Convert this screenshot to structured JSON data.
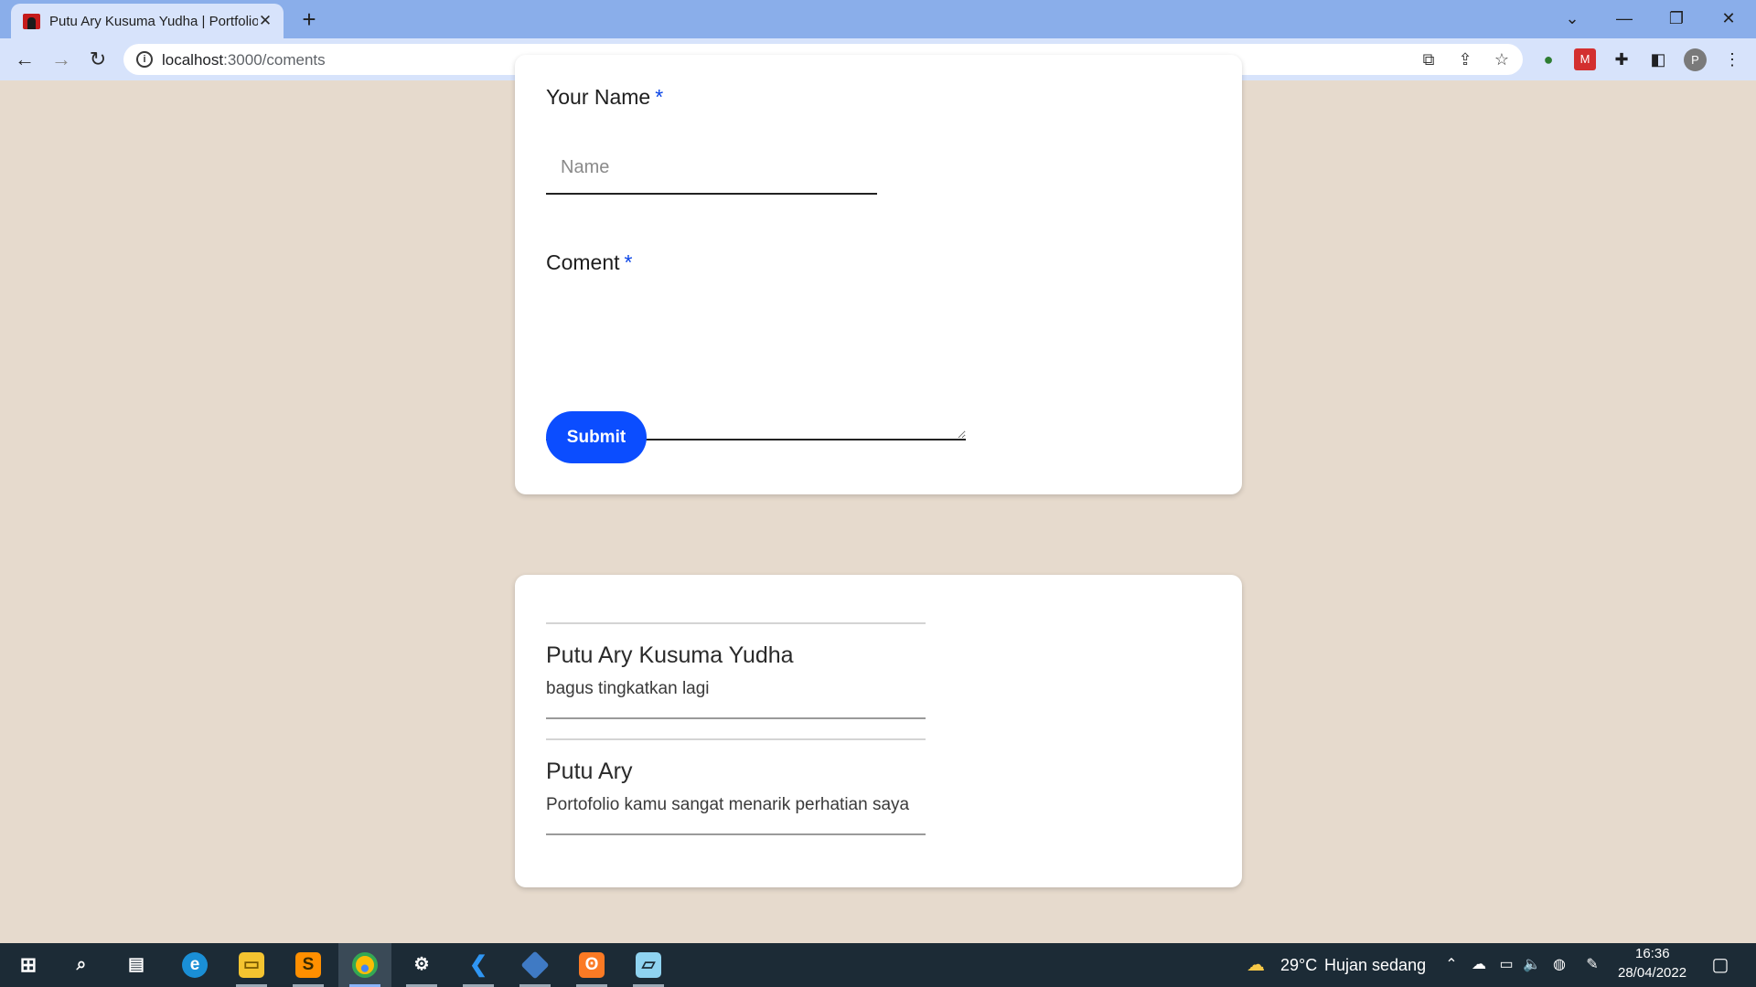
{
  "browser": {
    "tab_title": "Putu Ary Kusuma Yudha | Portfolio",
    "tab_close": "✕",
    "new_tab": "+",
    "url_host": "localhost",
    "url_rest": ":3000/coments",
    "avatar_letter": "P"
  },
  "form": {
    "name_label": "Your Name",
    "name_placeholder": "Name",
    "name_value": "",
    "comment_label": "Coment",
    "required_mark": "*",
    "submit_label": "Submit"
  },
  "comments": [
    {
      "name": "Putu Ary Kusuma Yudha",
      "text": "bagus tingkatkan lagi"
    },
    {
      "name": "Putu Ary",
      "text": "Portofolio kamu sangat menarik perhatian saya"
    }
  ],
  "taskbar": {
    "weather_temp": "29°C",
    "weather_desc": "Hujan sedang",
    "time": "16:36",
    "date": "28/04/2022"
  },
  "colors": {
    "page_bg": "#e6dacd",
    "accent": "#0b4dff",
    "required": "#0b45e6",
    "taskbar_bg": "#1c2b36"
  },
  "icons": {
    "taskbar_apps": [
      "windows-start-icon",
      "search-icon",
      "task-view-icon",
      "edge-icon",
      "file-explorer-icon",
      "sublime-text-icon",
      "chrome-icon",
      "settings-icon",
      "vscode-icon",
      "git-icon",
      "xampp-icon",
      "notepad-icon"
    ]
  }
}
